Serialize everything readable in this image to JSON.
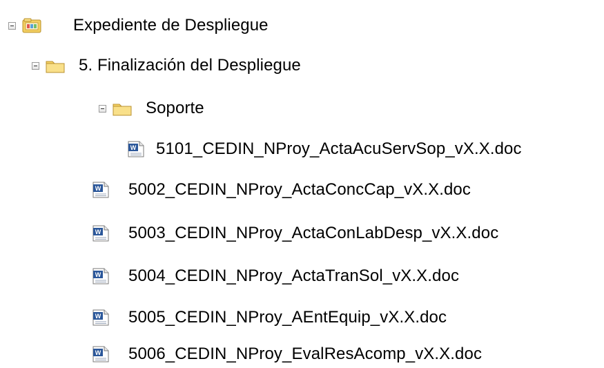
{
  "tree": {
    "root": {
      "label": "Expediente de Despliegue",
      "icon": "file-cabinet-icon",
      "expanded": true
    },
    "phase": {
      "label": "5. Finalización del Despliegue",
      "icon": "folder-icon",
      "expanded": true
    },
    "subfolder": {
      "label": "Soporte",
      "icon": "folder-icon",
      "expanded": true
    },
    "subfolder_files": [
      {
        "label": "5101_CEDIN_NProy_ActaAcuServSop_vX.X.doc",
        "icon": "word-document-icon"
      }
    ],
    "files": [
      {
        "label": "5002_CEDIN_NProy_ActaConcCap_vX.X.doc",
        "icon": "word-document-icon"
      },
      {
        "label": "5003_CEDIN_NProy_ActaConLabDesp_vX.X.doc",
        "icon": "word-document-icon"
      },
      {
        "label": "5004_CEDIN_NProy_ActaTranSol_vX.X.doc",
        "icon": "word-document-icon"
      },
      {
        "label": "5005_CEDIN_NProy_AEntEquip_vX.X.doc",
        "icon": "word-document-icon"
      },
      {
        "label": "5006_CEDIN_NProy_EvalResAcomp_vX.X.doc",
        "icon": "word-document-icon"
      }
    ]
  },
  "colors": {
    "folder_yellow": "#f6d365",
    "word_blue": "#2b579a",
    "toggle_border": "#9a9a9a"
  }
}
